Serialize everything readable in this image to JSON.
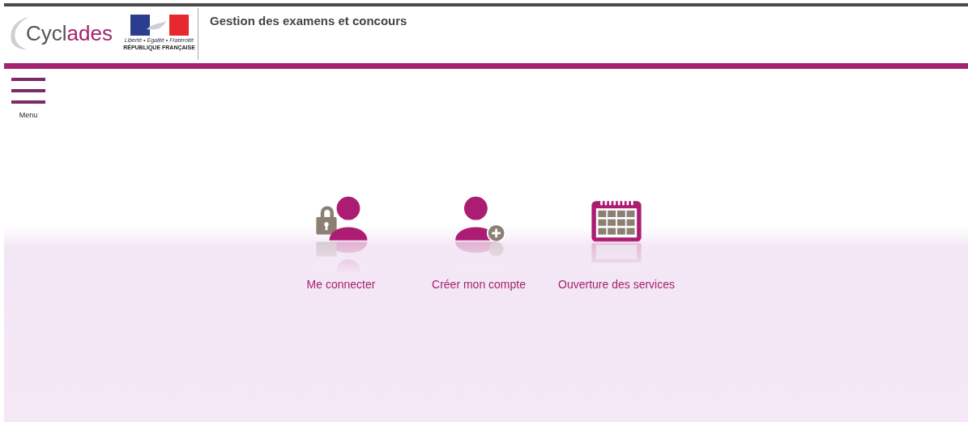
{
  "header": {
    "logo": {
      "text_start": "Cycl",
      "text_end": "ades"
    },
    "emblem": {
      "motto": "Liberté • Égalité • Fraternité",
      "name": "RÉPUBLIQUE FRANÇAISE"
    },
    "title": "Gestion des examens et concours"
  },
  "menu": {
    "label": "Menu"
  },
  "tiles": [
    {
      "kind": "login",
      "label": "Me connecter"
    },
    {
      "kind": "signup",
      "label": "Créer mon compte"
    },
    {
      "kind": "calendar",
      "label": "Ouverture des services"
    }
  ]
}
